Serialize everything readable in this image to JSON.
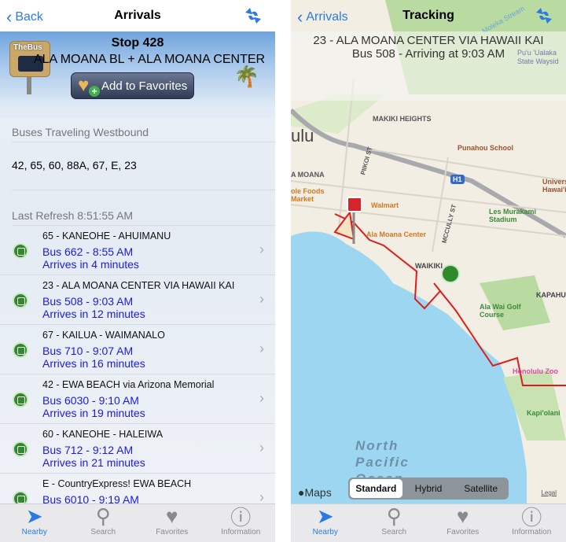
{
  "left": {
    "nav": {
      "back": "Back",
      "title": "Arrivals"
    },
    "hero": {
      "logo": "TheBus",
      "stop": "Stop 428",
      "stop_name": "ALA MOANA BL + ALA MOANA CENTER",
      "favorite_button": "Add to Favorites"
    },
    "direction_header": "Buses Traveling Westbound",
    "routes": "42, 65, 60, 88A, 67, E, 23",
    "last_refresh": "Last Refresh 8:51:55 AM",
    "arrivals": [
      {
        "route": "65 - KANEOHE - AHUIMANU",
        "bus": "Bus 662 -  8:55 AM",
        "eta": "Arrives in 4 minutes"
      },
      {
        "route": "23 - ALA MOANA CENTER VIA HAWAII KAI",
        "bus": "Bus 508 -  9:03 AM",
        "eta": "Arrives in 12 minutes"
      },
      {
        "route": "67 - KAILUA - WAIMANALO",
        "bus": "Bus 710 -  9:07 AM",
        "eta": "Arrives in 16 minutes"
      },
      {
        "route": "42 - EWA BEACH via Arizona Memorial",
        "bus": "Bus 6030 -  9:10 AM",
        "eta": "Arrives in 19 minutes"
      },
      {
        "route": "60 - KANEOHE - HALEIWA",
        "bus": "Bus 712 -  9:12 AM",
        "eta": "Arrives in 21 minutes"
      },
      {
        "route": "E - CountryExpress! EWA BEACH",
        "bus": "Bus 6010 -  9:19 AM",
        "eta": ""
      }
    ]
  },
  "right": {
    "nav": {
      "back": "Arrivals",
      "title": "Tracking"
    },
    "route": "23 - ALA MOANA CENTER VIA HAWAII KAI",
    "status": "Bus 508 - Arriving at 9:03 AM",
    "map_labels": [
      "MAKIKI HEIGHTS",
      "Punahou School",
      "ulu",
      "A MOANA",
      "ole Foods Market",
      "Walmart",
      "Ala Moana Center",
      "PIIKOI ST",
      "MCCULLY ST",
      "Les Murakami Stadium",
      "Univers Hawai'i",
      "WAIKIKI",
      "KAPAHU",
      "Ala Wai Golf Course",
      "Honolulu Zoo",
      "Kapi'olani",
      "North Pacific Ocean",
      "H1",
      "Pu'u 'Ualaka State Waysid",
      "Moleka Stream"
    ],
    "map_types": [
      "Standard",
      "Hybrid",
      "Satellite"
    ],
    "selected_map_type": "Standard",
    "attribution": "Maps",
    "legal": "Legal"
  },
  "tabs": [
    {
      "label": "Nearby",
      "icon": "location-arrow-icon"
    },
    {
      "label": "Search",
      "icon": "search-icon"
    },
    {
      "label": "Favorites",
      "icon": "heart-icon"
    },
    {
      "label": "Information",
      "icon": "info-icon"
    }
  ],
  "colors": {
    "accent": "#2a7be4",
    "bus_time": "#1a1ae6",
    "route_line": "#e01b1b",
    "bus_marker": "#2f8a2c"
  }
}
